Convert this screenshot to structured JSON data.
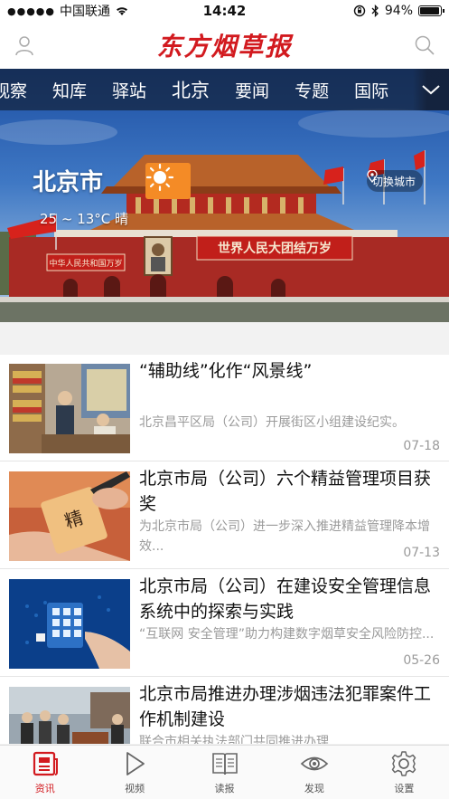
{
  "statusbar": {
    "carrier": "中国联通",
    "time": "14:42",
    "battery_percent": "94%",
    "battery_level": 0.94
  },
  "header": {
    "logo_text": "东方烟草报",
    "user_icon": "user-icon",
    "search_icon": "search-icon"
  },
  "channels": {
    "items": [
      "观察",
      "知库",
      "驿站",
      "北京",
      "要闻",
      "专题",
      "国际"
    ],
    "active": "北京",
    "more_icon": "chevron-down-icon"
  },
  "weather": {
    "city": "北京市",
    "temperature": "25 ~ 13°C 晴",
    "icon": "sun-icon",
    "switch_city_label": "切换城市"
  },
  "banner": {
    "gate_slogan_right": "世界人民大团结万岁",
    "gate_slogan_left": "中华人民共和国万岁"
  },
  "news": [
    {
      "title": "“辅助线”化作“风景线”",
      "summary": "北京昌平区局（公司）开展街区小组建设纪实。",
      "date": "07-18",
      "thumb": "shop-photo"
    },
    {
      "title": "北京市局（公司）六个精益管理项目获奖",
      "summary": "为北京市局（公司）进一步深入推进精益管理降本增效...",
      "date": "07-13",
      "thumb": "calligraphy-photo"
    },
    {
      "title": "北京市局（公司）在建设安全管理信息系统中的探索与实践",
      "summary": "“互联网 安全管理”助力构建数字烟草安全风险防控...",
      "date": "05-26",
      "thumb": "security-photo"
    },
    {
      "title": "北京市局推进办理涉烟违法犯罪案件工作机制建设",
      "summary": "联合市相关执法部门共同推进办理",
      "date": "",
      "thumb": "inspection-photo"
    }
  ],
  "tabs": [
    {
      "label": "资讯",
      "icon": "news-icon",
      "active": true
    },
    {
      "label": "视频",
      "icon": "play-icon",
      "active": false
    },
    {
      "label": "读报",
      "icon": "book-icon",
      "active": false
    },
    {
      "label": "发现",
      "icon": "eye-icon",
      "active": false
    },
    {
      "label": "设置",
      "icon": "gear-icon",
      "active": false
    }
  ],
  "colors": {
    "brand_red": "#d21a1f",
    "weather_orange": "#f48b26",
    "nav_bg": "#14223c"
  }
}
